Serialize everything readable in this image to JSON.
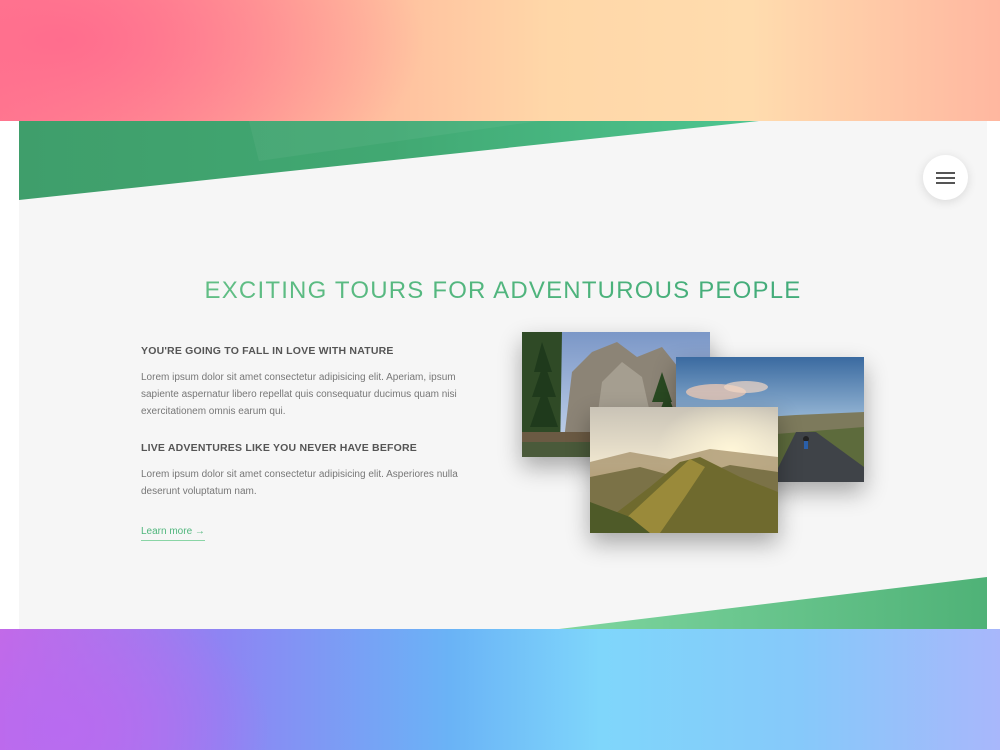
{
  "header": {
    "menu_icon": "hamburger-menu-icon"
  },
  "hero": {
    "headline": "EXCITING TOURS FOR ADVENTUROUS PEOPLE"
  },
  "features": [
    {
      "title": "YOU'RE GOING TO FALL IN LOVE WITH NATURE",
      "body": "Lorem ipsum dolor sit amet consectetur adipisicing elit. Aperiam, ipsum sapiente aspernatur libero repellat quis consequatur ducimus quam nisi exercitationem omnis earum qui."
    },
    {
      "title": "LIVE ADVENTURES LIKE YOU NEVER HAVE BEFORE",
      "body": "Lorem ipsum dolor sit amet consectetur adipisicing elit. Asperiores nulla deserunt voluptatum nam."
    }
  ],
  "cta": {
    "label": "Learn more →"
  },
  "gallery": [
    {
      "subject": "forest-cliffs-photo"
    },
    {
      "subject": "cyclist-road-photo"
    },
    {
      "subject": "mountain-ridge-hiker-photo"
    }
  ],
  "colors": {
    "accent_green": "#4dbb7a",
    "section_bg": "#f6f6f6",
    "top_band_start": "#ff7f91",
    "top_band_end": "#ffdcae",
    "bottom_band_start": "#c569e6",
    "bottom_band_end": "#86c9fa"
  }
}
